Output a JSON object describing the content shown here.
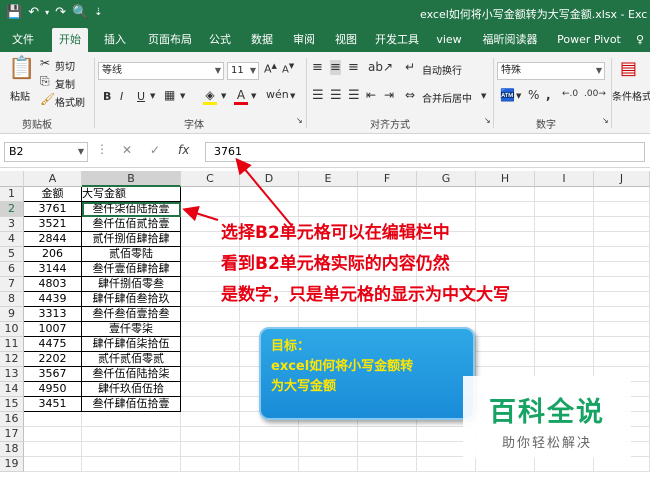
{
  "titlebar": {
    "title": "excel如何将小写金额转为大写金额.xlsx - Exc"
  },
  "tabs": [
    "文件",
    "开始",
    "插入",
    "页面布局",
    "公式",
    "数据",
    "审阅",
    "视图",
    "开发工具",
    "view",
    "福昕阅读器",
    "Power Pivot",
    "♀"
  ],
  "ribbon": {
    "clipboard": {
      "paste": "粘贴",
      "cut": "剪切",
      "copy": "复制",
      "format_painter": "格式刷",
      "label": "剪贴板"
    },
    "font": {
      "name": "等线",
      "size": "11",
      "label": "字体",
      "bold": "B",
      "italic": "I",
      "underline": "U"
    },
    "alignment": {
      "wrap": "自动换行",
      "merge": "合并后居中",
      "label": "对齐方式"
    },
    "number": {
      "format": "特殊",
      "label": "数字",
      "percent": "%",
      "comma": ","
    },
    "styles": {
      "cond_format": "条件格式"
    }
  },
  "formula_bar": {
    "name_box": "B2",
    "fx": "fx",
    "value": "3761"
  },
  "columns": [
    "A",
    "B",
    "C",
    "D",
    "E",
    "F",
    "G",
    "H",
    "I",
    "J"
  ],
  "rows": [
    {
      "num": "1",
      "a": "金额",
      "b": "大写金额"
    },
    {
      "num": "2",
      "a": "3761",
      "b": "叁仟柒佰陆拾壹"
    },
    {
      "num": "3",
      "a": "3521",
      "b": "叁仟伍佰贰拾壹"
    },
    {
      "num": "4",
      "a": "2844",
      "b": "贰仟捌佰肆拾肆"
    },
    {
      "num": "5",
      "a": "206",
      "b": "贰佰零陆"
    },
    {
      "num": "6",
      "a": "3144",
      "b": "叁仟壹佰肆拾肆"
    },
    {
      "num": "7",
      "a": "4803",
      "b": "肆仟捌佰零叁"
    },
    {
      "num": "8",
      "a": "4439",
      "b": "肆仟肆佰叁拾玖"
    },
    {
      "num": "9",
      "a": "3313",
      "b": "叁仟叁佰壹拾叁"
    },
    {
      "num": "10",
      "a": "1007",
      "b": "壹仟零柒"
    },
    {
      "num": "11",
      "a": "4475",
      "b": "肆仟肆佰柒拾伍"
    },
    {
      "num": "12",
      "a": "2202",
      "b": "贰仟贰佰零贰"
    },
    {
      "num": "13",
      "a": "3567",
      "b": "叁仟伍佰陆拾柒"
    },
    {
      "num": "14",
      "a": "4950",
      "b": "肆仟玖佰伍拾"
    },
    {
      "num": "15",
      "a": "3451",
      "b": "叁仟肆佰伍拾壹"
    },
    {
      "num": "16",
      "a": "",
      "b": ""
    },
    {
      "num": "17",
      "a": "",
      "b": ""
    },
    {
      "num": "18",
      "a": "",
      "b": ""
    },
    {
      "num": "19",
      "a": "",
      "b": ""
    }
  ],
  "annotation": {
    "line1": "选择B2单元格可以在编辑栏中",
    "line2": "看到B2单元格实际的内容仍然",
    "line3": "是数字，只是单元格的显示为中文大写"
  },
  "goal": {
    "line1": "目标：",
    "line2": "excel如何将小写金额转",
    "line3": "为大写金额"
  },
  "watermark": {
    "title": "百科全说",
    "subtitle": "助你轻松解决"
  },
  "colors": {
    "excel_green": "#217346",
    "annotation_red": "#e60012",
    "goal_bg": "#1a8cd8",
    "goal_text": "#ffe600",
    "watermark_green": "#16a363"
  }
}
